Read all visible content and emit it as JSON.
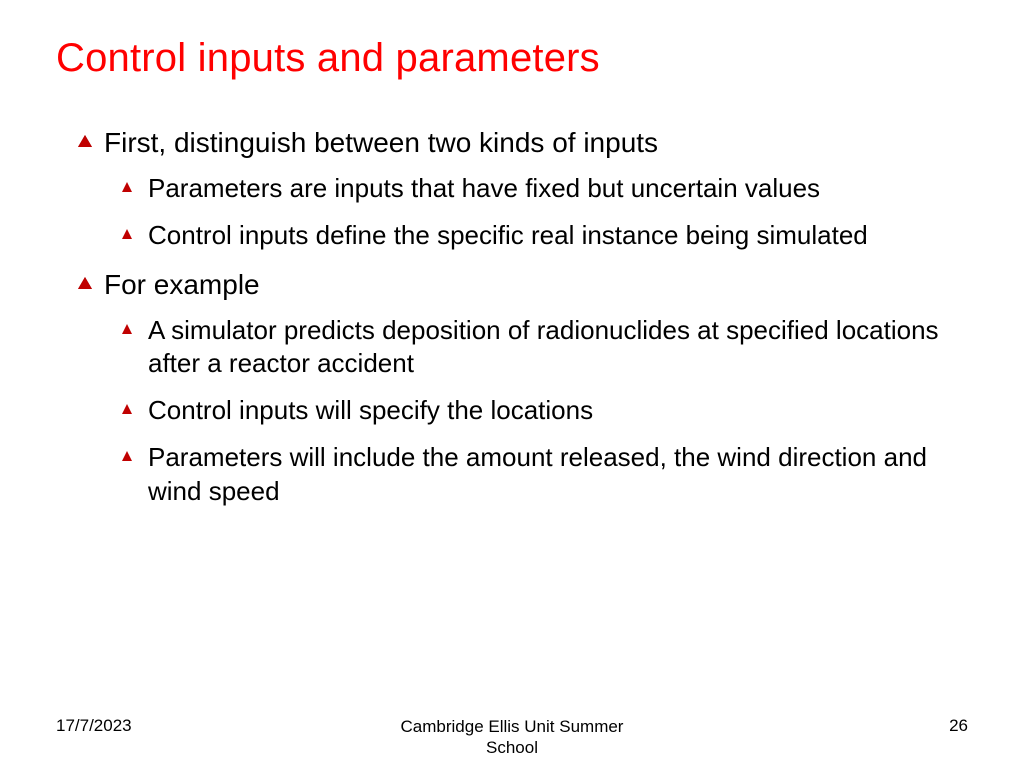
{
  "title": "Control inputs and parameters",
  "bullets": [
    {
      "text": "First, distinguish between two kinds of inputs",
      "children": [
        "Parameters are inputs that have fixed but uncertain values",
        "Control inputs define the specific real instance being simulated"
      ]
    },
    {
      "text": "For example",
      "children": [
        "A simulator predicts deposition of radionuclides at specified locations after a reactor accident",
        "Control inputs will specify the locations",
        "Parameters will include the amount released, the wind direction and wind speed"
      ]
    }
  ],
  "footer": {
    "date": "17/7/2023",
    "venue": "Cambridge Ellis Unit Summer School",
    "page": "26"
  }
}
